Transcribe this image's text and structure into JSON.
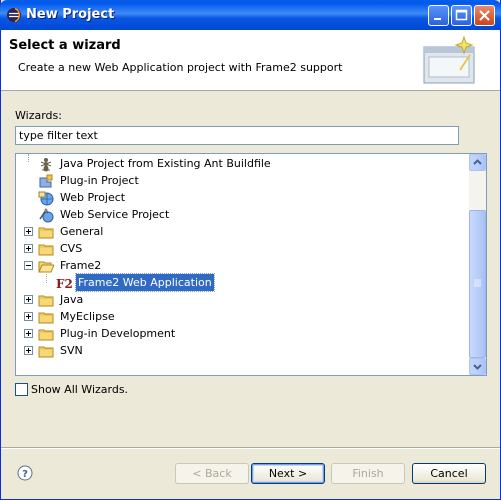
{
  "window": {
    "title": "New Project"
  },
  "header": {
    "title": "Select a wizard",
    "description": "Create a new Web Application project with Frame2 support"
  },
  "filter": {
    "label": "Wizards:",
    "value": "type filter text"
  },
  "tree": {
    "items": [
      {
        "label": "Java Project from Existing Ant Buildfile",
        "icon": "ant-icon"
      },
      {
        "label": "Plug-in Project",
        "icon": "plugin-project-icon"
      },
      {
        "label": "Web Project",
        "icon": "web-project-icon"
      },
      {
        "label": "Web Service Project",
        "icon": "web-service-icon"
      },
      {
        "label": "General",
        "icon": "folder-icon"
      },
      {
        "label": "CVS",
        "icon": "folder-icon"
      },
      {
        "label": "Frame2",
        "icon": "folder-open-icon"
      },
      {
        "label": "Frame2 Web Application",
        "icon": "f2-icon",
        "selected": true
      },
      {
        "label": "Java",
        "icon": "folder-icon"
      },
      {
        "label": "MyEclipse",
        "icon": "folder-icon"
      },
      {
        "label": "Plug-in Development",
        "icon": "folder-icon"
      },
      {
        "label": "SVN",
        "icon": "folder-icon"
      }
    ]
  },
  "show_all": {
    "label": "Show All Wizards.",
    "checked": false
  },
  "buttons": {
    "back": "< Back",
    "next": "Next >",
    "finish": "Finish",
    "cancel": "Cancel"
  },
  "colors": {
    "selection": "#316ac5",
    "dialog_bg": "#ece9d8",
    "titlebar": "#0058ee"
  }
}
